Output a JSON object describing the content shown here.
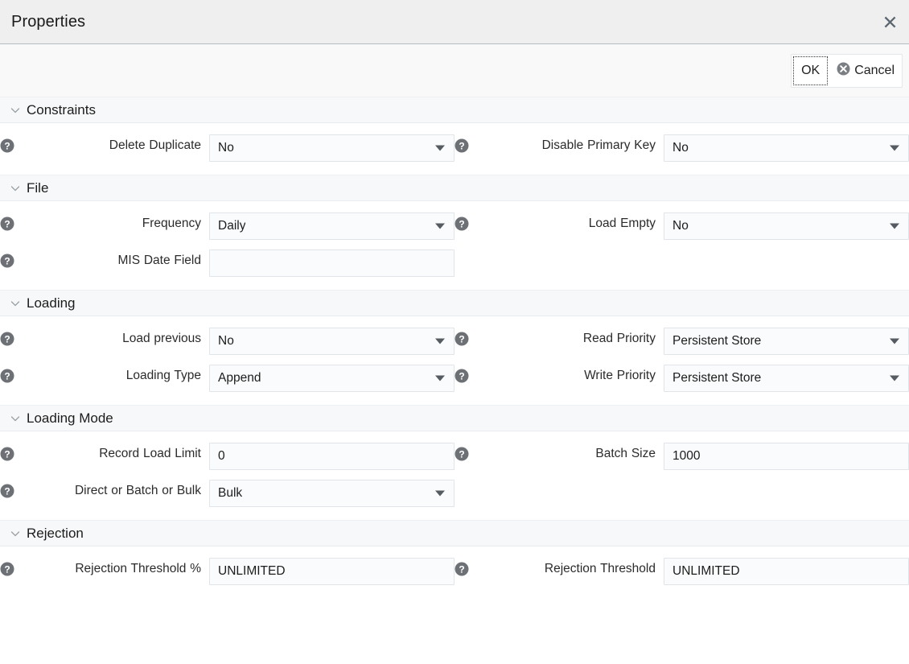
{
  "window": {
    "title": "Properties",
    "close_icon": "close-icon"
  },
  "toolbar": {
    "ok_label": "OK",
    "cancel_label": "Cancel",
    "cancel_icon": "cancel-circle-x-icon"
  },
  "sections": [
    {
      "title": "Constraints",
      "rows": [
        {
          "left": {
            "label": "Delete Duplicate",
            "value": "No",
            "type": "select",
            "help": true
          },
          "right": {
            "label": "Disable Primary Key",
            "value": "No",
            "type": "select",
            "help": true
          }
        }
      ]
    },
    {
      "title": "File",
      "rows": [
        {
          "left": {
            "label": "Frequency",
            "value": "Daily",
            "type": "select",
            "help": true
          },
          "right": {
            "label": "Load Empty",
            "value": "No",
            "type": "select",
            "help": true
          }
        },
        {
          "left": {
            "label": "MIS Date Field",
            "value": "",
            "type": "text",
            "help": true
          },
          "right": null
        }
      ]
    },
    {
      "title": "Loading",
      "rows": [
        {
          "left": {
            "label": "Load previous",
            "value": "No",
            "type": "select",
            "help": true
          },
          "right": {
            "label": "Read Priority",
            "value": "Persistent Store",
            "type": "select",
            "help": true
          }
        },
        {
          "left": {
            "label": "Loading Type",
            "value": "Append",
            "type": "select",
            "help": true
          },
          "right": {
            "label": "Write Priority",
            "value": "Persistent Store",
            "type": "select",
            "help": true
          }
        }
      ]
    },
    {
      "title": "Loading Mode",
      "rows": [
        {
          "left": {
            "label": "Record Load Limit",
            "value": "0",
            "type": "text",
            "help": true
          },
          "right": {
            "label": "Batch Size",
            "value": "1000",
            "type": "text",
            "help": true
          }
        },
        {
          "left": {
            "label": "Direct or Batch or Bulk",
            "value": "Bulk",
            "type": "select",
            "help": true
          },
          "right": null
        }
      ]
    },
    {
      "title": "Rejection",
      "rows": [
        {
          "left": {
            "label": "Rejection Threshold %",
            "value": "UNLIMITED",
            "type": "text",
            "help": true
          },
          "right": {
            "label": "Rejection Threshold",
            "value": "UNLIMITED",
            "type": "text",
            "help": true
          }
        }
      ]
    }
  ],
  "colors": {
    "titlebar_bg": "#efefef",
    "section_header_bg": "#f7f8f9",
    "field_bg": "#fafbfc",
    "field_border": "#e1e4e8",
    "help_icon": "#6d7176",
    "caret": "#555b60"
  }
}
